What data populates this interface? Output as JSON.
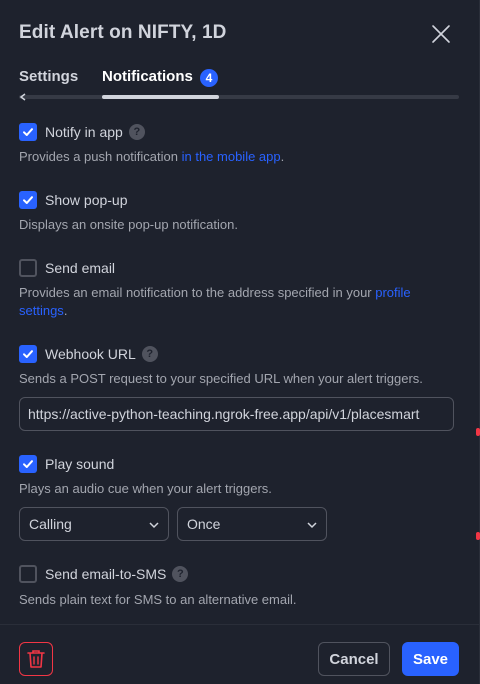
{
  "dialog": {
    "title": "Edit Alert on NIFTY, 1D"
  },
  "tabs": {
    "settings": "Settings",
    "notifications": "Notifications",
    "notifications_badge": "4"
  },
  "options": {
    "notify_in_app": {
      "label": "Notify in app",
      "checked": true,
      "desc_prefix": "Provides a push notification ",
      "desc_link": "in the mobile app",
      "desc_suffix": "."
    },
    "show_popup": {
      "label": "Show pop-up",
      "checked": true,
      "desc": "Displays an onsite pop-up notification."
    },
    "send_email": {
      "label": "Send email",
      "checked": false,
      "desc_prefix": "Provides an email notification to the address specified in your ",
      "desc_link": "profile settings",
      "desc_suffix": "."
    },
    "webhook_url": {
      "label": "Webhook URL",
      "checked": true,
      "desc": "Sends a POST request to your specified URL when your alert triggers.",
      "value": "https://active-python-teaching.ngrok-free.app/api/v1/placesmart"
    },
    "play_sound": {
      "label": "Play sound",
      "checked": true,
      "desc": "Plays an audio cue when your alert triggers.",
      "sound_value": "Calling",
      "repeat_value": "Once"
    },
    "email_to_sms": {
      "label": "Send email-to-SMS",
      "checked": false,
      "desc": "Sends plain text for SMS to an alternative email."
    }
  },
  "footer": {
    "cancel_label": "Cancel",
    "save_label": "Save"
  },
  "colors": {
    "background": "#1e222d",
    "accent": "#2962ff",
    "danger": "#f23645",
    "text": "#d1d4dc",
    "muted_text": "#a3a6af",
    "border": "#50535e"
  },
  "icons": {
    "close": "close-icon",
    "help": "help-icon",
    "check": "checkmark-icon",
    "chevron": "chevron-down-icon",
    "delete": "trash-icon"
  }
}
